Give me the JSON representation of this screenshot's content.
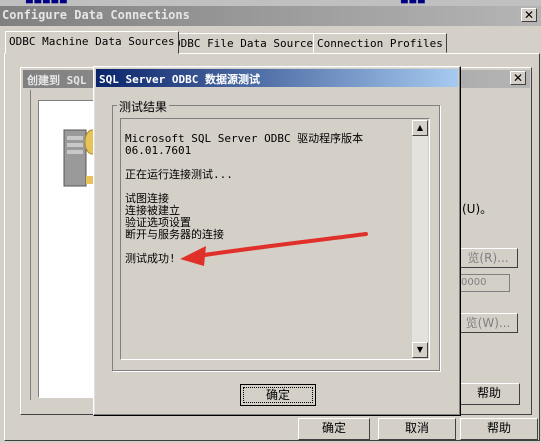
{
  "outer_window": {
    "title": "Configure Data Connections",
    "tabs": [
      "ODBC Machine Data Sources",
      "ODBC File Data Sources",
      "Connection Profiles"
    ],
    "buttons": {
      "ok": "确定",
      "cancel": "取消",
      "help": "帮助"
    }
  },
  "mid_dialog": {
    "title": "创建到 SQL",
    "option_text": "(U)。",
    "browse1": "览(R)...",
    "path_value": "0000",
    "browse2": "览(W)...",
    "help": "帮助"
  },
  "test_dialog": {
    "title": "SQL Server ODBC 数据源测试",
    "group_label": "测试结果",
    "result_lines": [
      "Microsoft SQL Server ODBC 驱动程序版本",
      "06.01.7601",
      "",
      "正在运行连接测试...",
      "",
      "试图连接",
      "连接被建立",
      "验证选项设置",
      "断开与服务器的连接",
      "",
      "测试成功!"
    ],
    "ok_button": "确定"
  },
  "colors": {
    "active_title": "#0a246a",
    "inactive_title": "#808080",
    "arrow": "#e0302a",
    "dialog_bg": "#d4d0c8"
  },
  "icons": {
    "close": "close-icon",
    "scroll_up": "scroll-up-arrow-icon",
    "scroll_down": "scroll-down-arrow-icon",
    "server": "server-icon",
    "annotation": "red-arrow-icon"
  }
}
